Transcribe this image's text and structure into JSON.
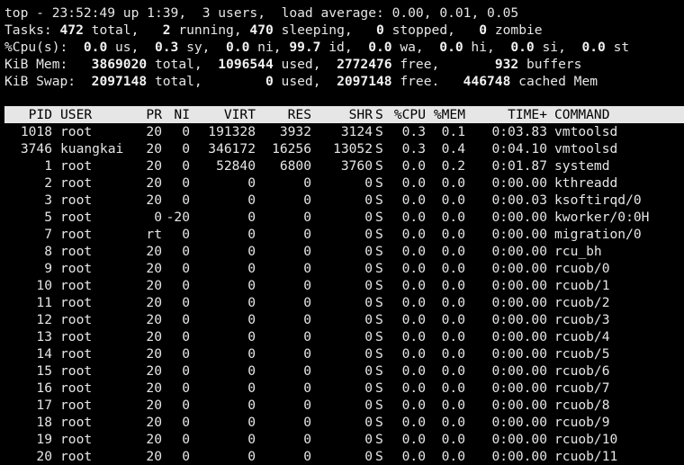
{
  "summary": {
    "uptime": {
      "prefix": "top - ",
      "time": "23:52:49",
      "up": " up ",
      "uptime": "1:39",
      "sep1": ",  ",
      "users_count": "3",
      "users_label": " users,  ",
      "load_label": "load average: ",
      "load1": "0.00",
      "sep2": ", ",
      "load5": "0.01",
      "sep3": ", ",
      "load15": "0.05"
    },
    "tasks": {
      "label": "Tasks: ",
      "total": "472",
      "total_label": " total,   ",
      "running": "2",
      "running_label": " running, ",
      "sleeping": "470",
      "sleeping_label": " sleeping,   ",
      "stopped": "0",
      "stopped_label": " stopped,   ",
      "zombie": "0",
      "zombie_label": " zombie"
    },
    "cpu": {
      "label": "%Cpu(s):  ",
      "us": "0.0",
      "us_label": " us,  ",
      "sy": "0.3",
      "sy_label": " sy,  ",
      "ni": "0.0",
      "ni_label": " ni, ",
      "id": "99.7",
      "id_label": " id,  ",
      "wa": "0.0",
      "wa_label": " wa,  ",
      "hi": "0.0",
      "hi_label": " hi,  ",
      "si": "0.0",
      "si_label": " si,  ",
      "st": "0.0",
      "st_label": " st"
    },
    "mem": {
      "label": "KiB Mem:   ",
      "total": "3869020",
      "total_label": " total,  ",
      "used": "1096544",
      "used_label": " used,  ",
      "free": "2772476",
      "free_label": " free,       ",
      "buffers": "932",
      "buffers_label": " buffers"
    },
    "swap": {
      "label": "KiB Swap:  ",
      "total": "2097148",
      "total_label": " total,        ",
      "used": "0",
      "used_label": " used,  ",
      "free": "2097148",
      "free_label": " free.   ",
      "cached": "446748",
      "cached_label": " cached Mem"
    }
  },
  "columns": [
    "PID",
    "USER",
    "PR",
    "NI",
    "VIRT",
    "RES",
    "SHR",
    "S",
    "%CPU",
    "%MEM",
    "TIME+",
    "COMMAND"
  ],
  "processes": [
    [
      "1018",
      "root",
      "20",
      "0",
      "191328",
      "3932",
      "3124",
      "S",
      "0.3",
      "0.1",
      "0:03.83",
      "vmtoolsd"
    ],
    [
      "3746",
      "kuangkai",
      "20",
      "0",
      "346172",
      "16256",
      "13052",
      "S",
      "0.3",
      "0.4",
      "0:04.10",
      "vmtoolsd"
    ],
    [
      "1",
      "root",
      "20",
      "0",
      "52840",
      "6800",
      "3760",
      "S",
      "0.0",
      "0.2",
      "0:01.87",
      "systemd"
    ],
    [
      "2",
      "root",
      "20",
      "0",
      "0",
      "0",
      "0",
      "S",
      "0.0",
      "0.0",
      "0:00.00",
      "kthreadd"
    ],
    [
      "3",
      "root",
      "20",
      "0",
      "0",
      "0",
      "0",
      "S",
      "0.0",
      "0.0",
      "0:00.03",
      "ksoftirqd/0"
    ],
    [
      "5",
      "root",
      "0",
      "-20",
      "0",
      "0",
      "0",
      "S",
      "0.0",
      "0.0",
      "0:00.00",
      "kworker/0:0H"
    ],
    [
      "7",
      "root",
      "rt",
      "0",
      "0",
      "0",
      "0",
      "S",
      "0.0",
      "0.0",
      "0:00.00",
      "migration/0"
    ],
    [
      "8",
      "root",
      "20",
      "0",
      "0",
      "0",
      "0",
      "S",
      "0.0",
      "0.0",
      "0:00.00",
      "rcu_bh"
    ],
    [
      "9",
      "root",
      "20",
      "0",
      "0",
      "0",
      "0",
      "S",
      "0.0",
      "0.0",
      "0:00.00",
      "rcuob/0"
    ],
    [
      "10",
      "root",
      "20",
      "0",
      "0",
      "0",
      "0",
      "S",
      "0.0",
      "0.0",
      "0:00.00",
      "rcuob/1"
    ],
    [
      "11",
      "root",
      "20",
      "0",
      "0",
      "0",
      "0",
      "S",
      "0.0",
      "0.0",
      "0:00.00",
      "rcuob/2"
    ],
    [
      "12",
      "root",
      "20",
      "0",
      "0",
      "0",
      "0",
      "S",
      "0.0",
      "0.0",
      "0:00.00",
      "rcuob/3"
    ],
    [
      "13",
      "root",
      "20",
      "0",
      "0",
      "0",
      "0",
      "S",
      "0.0",
      "0.0",
      "0:00.00",
      "rcuob/4"
    ],
    [
      "14",
      "root",
      "20",
      "0",
      "0",
      "0",
      "0",
      "S",
      "0.0",
      "0.0",
      "0:00.00",
      "rcuob/5"
    ],
    [
      "15",
      "root",
      "20",
      "0",
      "0",
      "0",
      "0",
      "S",
      "0.0",
      "0.0",
      "0:00.00",
      "rcuob/6"
    ],
    [
      "16",
      "root",
      "20",
      "0",
      "0",
      "0",
      "0",
      "S",
      "0.0",
      "0.0",
      "0:00.00",
      "rcuob/7"
    ],
    [
      "17",
      "root",
      "20",
      "0",
      "0",
      "0",
      "0",
      "S",
      "0.0",
      "0.0",
      "0:00.00",
      "rcuob/8"
    ],
    [
      "18",
      "root",
      "20",
      "0",
      "0",
      "0",
      "0",
      "S",
      "0.0",
      "0.0",
      "0:00.00",
      "rcuob/9"
    ],
    [
      "19",
      "root",
      "20",
      "0",
      "0",
      "0",
      "0",
      "S",
      "0.0",
      "0.0",
      "0:00.00",
      "rcuob/10"
    ],
    [
      "20",
      "root",
      "20",
      "0",
      "0",
      "0",
      "0",
      "S",
      "0.0",
      "0.0",
      "0:00.00",
      "rcuob/11"
    ]
  ]
}
